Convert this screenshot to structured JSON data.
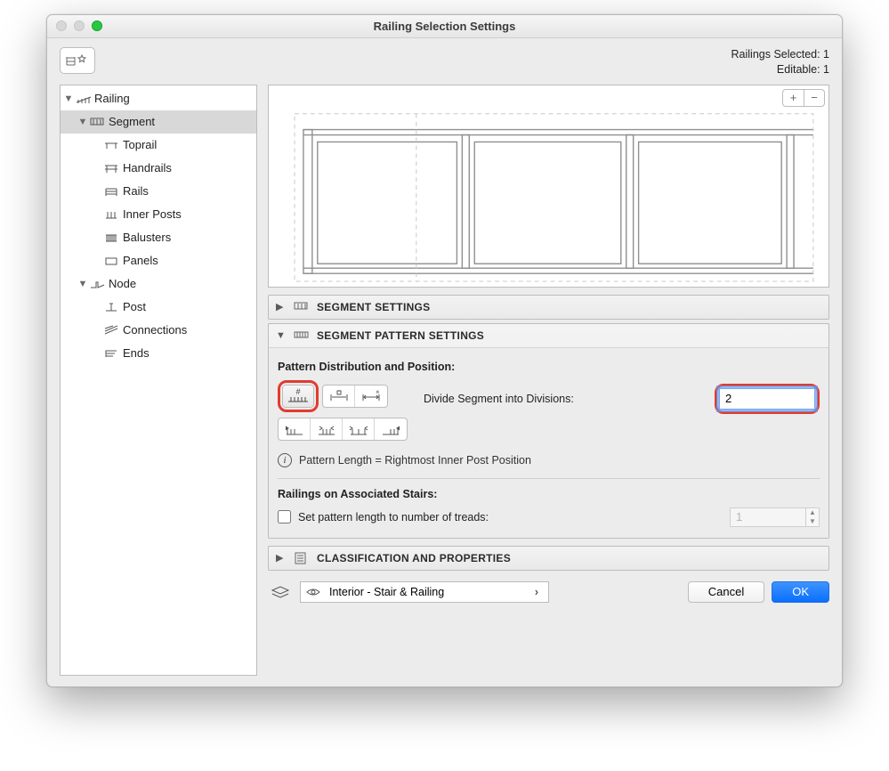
{
  "window": {
    "title": "Railing Selection Settings"
  },
  "status": {
    "selected_label": "Railings Selected: 1",
    "editable_label": "Editable: 1"
  },
  "tree": {
    "railing": "Railing",
    "segment": "Segment",
    "toprail": "Toprail",
    "handrails": "Handrails",
    "rails": "Rails",
    "inner_posts": "Inner Posts",
    "balusters": "Balusters",
    "panels": "Panels",
    "node": "Node",
    "post": "Post",
    "connections": "Connections",
    "ends": "Ends"
  },
  "sections": {
    "segment_settings": "SEGMENT SETTINGS",
    "segment_pattern": "SEGMENT PATTERN SETTINGS",
    "classification": "CLASSIFICATION AND PROPERTIES"
  },
  "pattern": {
    "heading": "Pattern Distribution and Position:",
    "divide_label": "Divide Segment into Divisions:",
    "divide_value": "2",
    "info_text": "Pattern Length = Rightmost Inner Post Position",
    "stairs_heading": "Railings on Associated Stairs:",
    "set_treads_label": "Set pattern length to number of treads:",
    "treads_value": "1"
  },
  "layer": {
    "name": "Interior - Stair & Railing"
  },
  "buttons": {
    "cancel": "Cancel",
    "ok": "OK",
    "plus": "+",
    "minus": "−"
  }
}
